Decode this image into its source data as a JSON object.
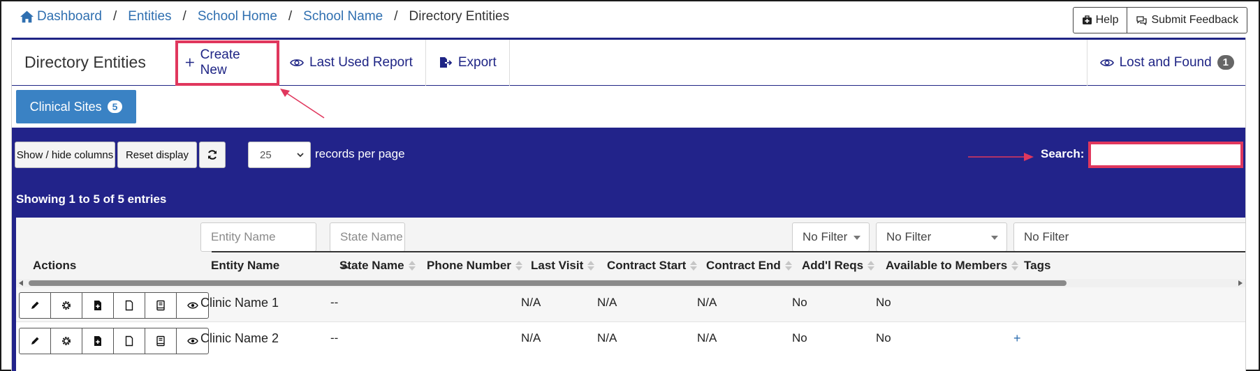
{
  "breadcrumb": {
    "items": [
      "Dashboard",
      "Entities",
      "School Home",
      "School Name"
    ],
    "separator": "/",
    "current": "Directory Entities"
  },
  "top_buttons": {
    "help": "Help",
    "feedback": "Submit Feedback"
  },
  "header": {
    "title": "Directory Entities",
    "create": "Create New",
    "last_report": "Last Used Report",
    "export": "Export",
    "lost_found": "Lost and Found",
    "lost_found_count": "1"
  },
  "tab": {
    "label": "Clinical Sites",
    "count": "5"
  },
  "controls": {
    "show_hide": "Show / hide columns",
    "reset": "Reset display",
    "per_page": "25",
    "per_page_label": "records per page",
    "search_label": "Search:",
    "search_value": ""
  },
  "showing": "Showing 1 to 5 of 5 entries",
  "filters": {
    "entity_name": "Entity Name",
    "state_name": "State Name",
    "no_filter_1": "No Filter",
    "no_filter_2": "No Filter",
    "no_filter_3": "No Filter"
  },
  "columns": {
    "actions": "Actions",
    "entity_name": "Entity Name",
    "state_name": "State Name",
    "phone": "Phone Number",
    "last_visit": "Last Visit",
    "contract_start": "Contract Start",
    "contract_end": "Contract End",
    "addl_reqs": "Add'l Reqs",
    "available": "Available to Members",
    "tags": "Tags"
  },
  "rows": [
    {
      "entity_name": "Clinic Name 1",
      "state_name": "--",
      "phone": "",
      "last_visit": "N/A",
      "contract_start": "N/A",
      "contract_end": "N/A",
      "addl_reqs": "No",
      "available": "No",
      "tags": ""
    },
    {
      "entity_name": "Clinic Name 2",
      "state_name": "--",
      "phone": "",
      "last_visit": "N/A",
      "contract_start": "N/A",
      "contract_end": "N/A",
      "addl_reqs": "No",
      "available": "No",
      "tags": "+"
    }
  ],
  "colors": {
    "navy": "#22238a",
    "tab_blue": "#3a82c4",
    "link_blue": "#2f6fb0",
    "highlight": "#e0375d"
  },
  "icons": [
    "home-icon",
    "help-kit-icon",
    "feedback-icon",
    "plus-icon",
    "eye-icon",
    "export-icon",
    "refresh-icon",
    "pencil-icon",
    "gear-icon",
    "file-plus-icon",
    "file-icon",
    "book-icon"
  ]
}
